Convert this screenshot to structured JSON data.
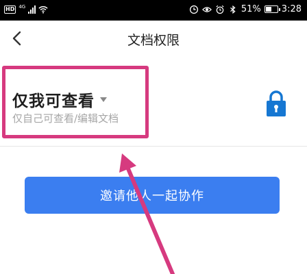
{
  "status_bar": {
    "hd": "HD",
    "network": "4G",
    "battery_text": "51%",
    "battery_level": 0.51,
    "time": "3:28"
  },
  "header": {
    "back_icon": "chevron-left-icon",
    "title": "文档权限"
  },
  "permission": {
    "title": "仅我可查看",
    "description": "仅自己可查看/编辑文档",
    "lock_icon": "lock-icon",
    "lock_color": "#1677d2"
  },
  "invite_button": {
    "label": "邀请他人一起协作",
    "color": "#3b7ef0"
  },
  "annotation": {
    "color": "#d63a7f"
  }
}
